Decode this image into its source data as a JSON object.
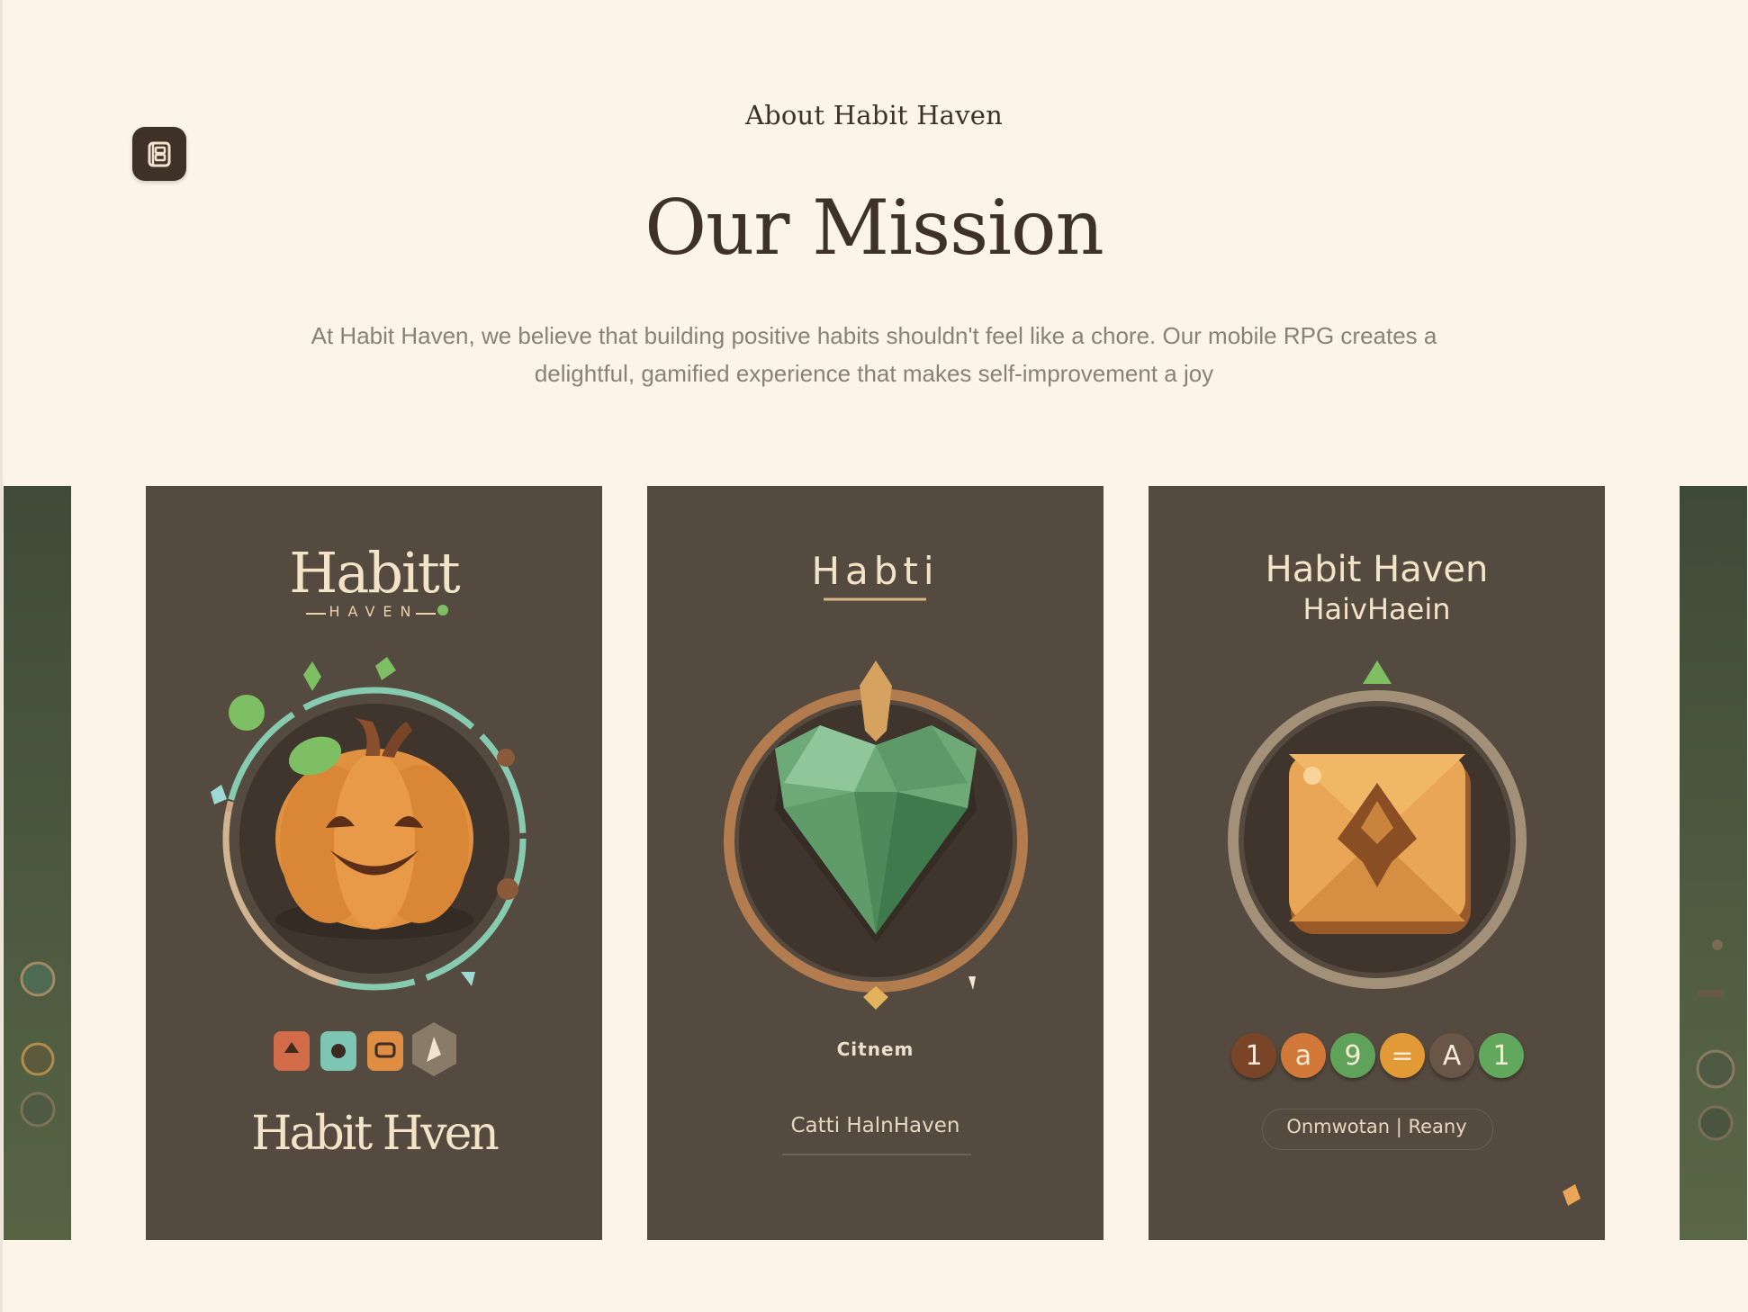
{
  "header": {
    "eyebrow": "About Habit Haven",
    "title": "Our Mission",
    "description": "At Habit Haven, we believe that building positive habits shouldn't feel like a chore. Our mobile RPG creates a delightful, gamified experience that makes self-improvement a joy"
  },
  "logo": {
    "icon": "book-logo-icon"
  },
  "cards": [
    {
      "top_text": "Habitt",
      "sub_text": "HAVEN",
      "bottom_text": "Habit Hven",
      "icon": "pumpkin-icon"
    },
    {
      "top_text": "Habti",
      "mid_text": "Citnem",
      "bottom_text": "Catti HalnHaven",
      "icon": "green-gem-icon"
    },
    {
      "top_text": "Habit Haven",
      "sub_text": "HaivHaein",
      "bottom_text": "Onmwotan | Reany",
      "icon": "orange-tile-icon",
      "chips": [
        "1",
        "a",
        "9",
        "=",
        "A",
        "1"
      ]
    }
  ],
  "colors": {
    "background": "#fcf4e8",
    "card": "#554a3f",
    "heading": "#3d3128",
    "body_text": "#8a8078",
    "accent_green": "#6fae74",
    "accent_orange": "#e09a45"
  }
}
